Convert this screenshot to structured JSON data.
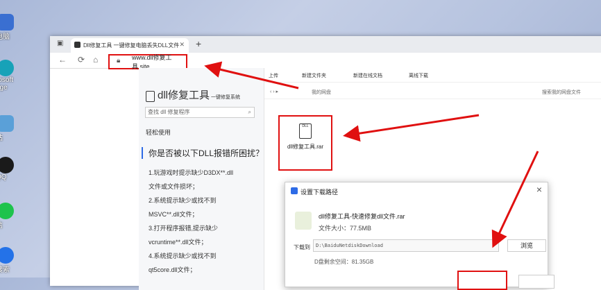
{
  "desktop": {
    "icons": [
      {
        "label": "电脑",
        "color": "#3a6fd1"
      },
      {
        "label": "rosoft\ndge",
        "color": "#17a2b8"
      },
      {
        "label": "站",
        "color": "#5aa0d8"
      },
      {
        "label": "QQ",
        "color": "#1a1a1a"
      },
      {
        "label": "信",
        "color": "#1ec34c"
      },
      {
        "label": "搜索",
        "color": "#2472e8"
      }
    ]
  },
  "browser": {
    "tab_title": "Dll修复工具 一键修复电脑丢失DLL文件",
    "new_tab_symbol": "+",
    "url": "www.dll修复工具.site"
  },
  "left_panel": {
    "brand": "dll修复工具",
    "brand_sub": "一键修复系统",
    "search_placeholder": "查找 dll 修复程序",
    "easy_use": "轻松使用",
    "question_title": "你是否被以下DLL报错所困扰？",
    "tips": [
      "1.玩游戏时提示缺少D3DX**.dll",
      "文件或文件损坏；",
      "2.系统提示缺少或找不到",
      "MSVC**.dll文件；",
      "3.打开程序报错,提示缺少",
      "vcruntime**.dll文件；",
      "4.系统提示缺少或找不到",
      "qt5core.dll文件；"
    ]
  },
  "netdisk": {
    "toolbar": [
      "上传",
      "新建文件夹",
      "新建在线文档",
      "离线下载"
    ],
    "breadcrumb": "我的网盘",
    "search_placeholder": "搜索我的网盘文件",
    "file_name": "dll修复工具.rar"
  },
  "dialog": {
    "title": "设置下载路径",
    "file_name": "dll修复工具-快速修复dll文件.rar",
    "file_size": "文件大小：77.5MB",
    "download_to_label": "下载到",
    "path": "D:\\BaiduNetdiskDownload",
    "browse_label": "浏览",
    "free_space": "D盘剩余空间：81.35GB"
  },
  "colors": {
    "highlight_red": "#e01010",
    "accent_blue": "#2e6be6"
  }
}
